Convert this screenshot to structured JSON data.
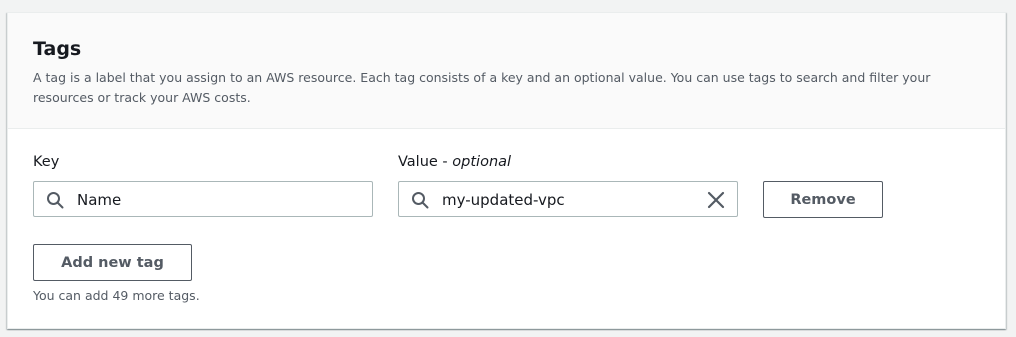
{
  "section": {
    "title": "Tags",
    "description": "A tag is a label that you assign to an AWS resource. Each tag consists of a key and an optional value. You can use tags to search and filter your resources or track your AWS costs."
  },
  "tag_row": {
    "key_label": "Key",
    "value_label": "Value",
    "value_label_suffix": "optional",
    "value_label_separator": " - ",
    "key_value": "Name",
    "value_value": "my-updated-vpc",
    "key_icon": "search-icon",
    "value_icon": "search-icon",
    "clear_icon": "close-icon",
    "remove_label": "Remove"
  },
  "actions": {
    "add_label": "Add new tag",
    "hint": "You can add 49 more tags."
  },
  "colors": {
    "background": "#f2f3f3",
    "header_background": "#fafafa",
    "text": "#16191f",
    "secondary_text": "#545b64",
    "input_border": "#aab7b8"
  }
}
